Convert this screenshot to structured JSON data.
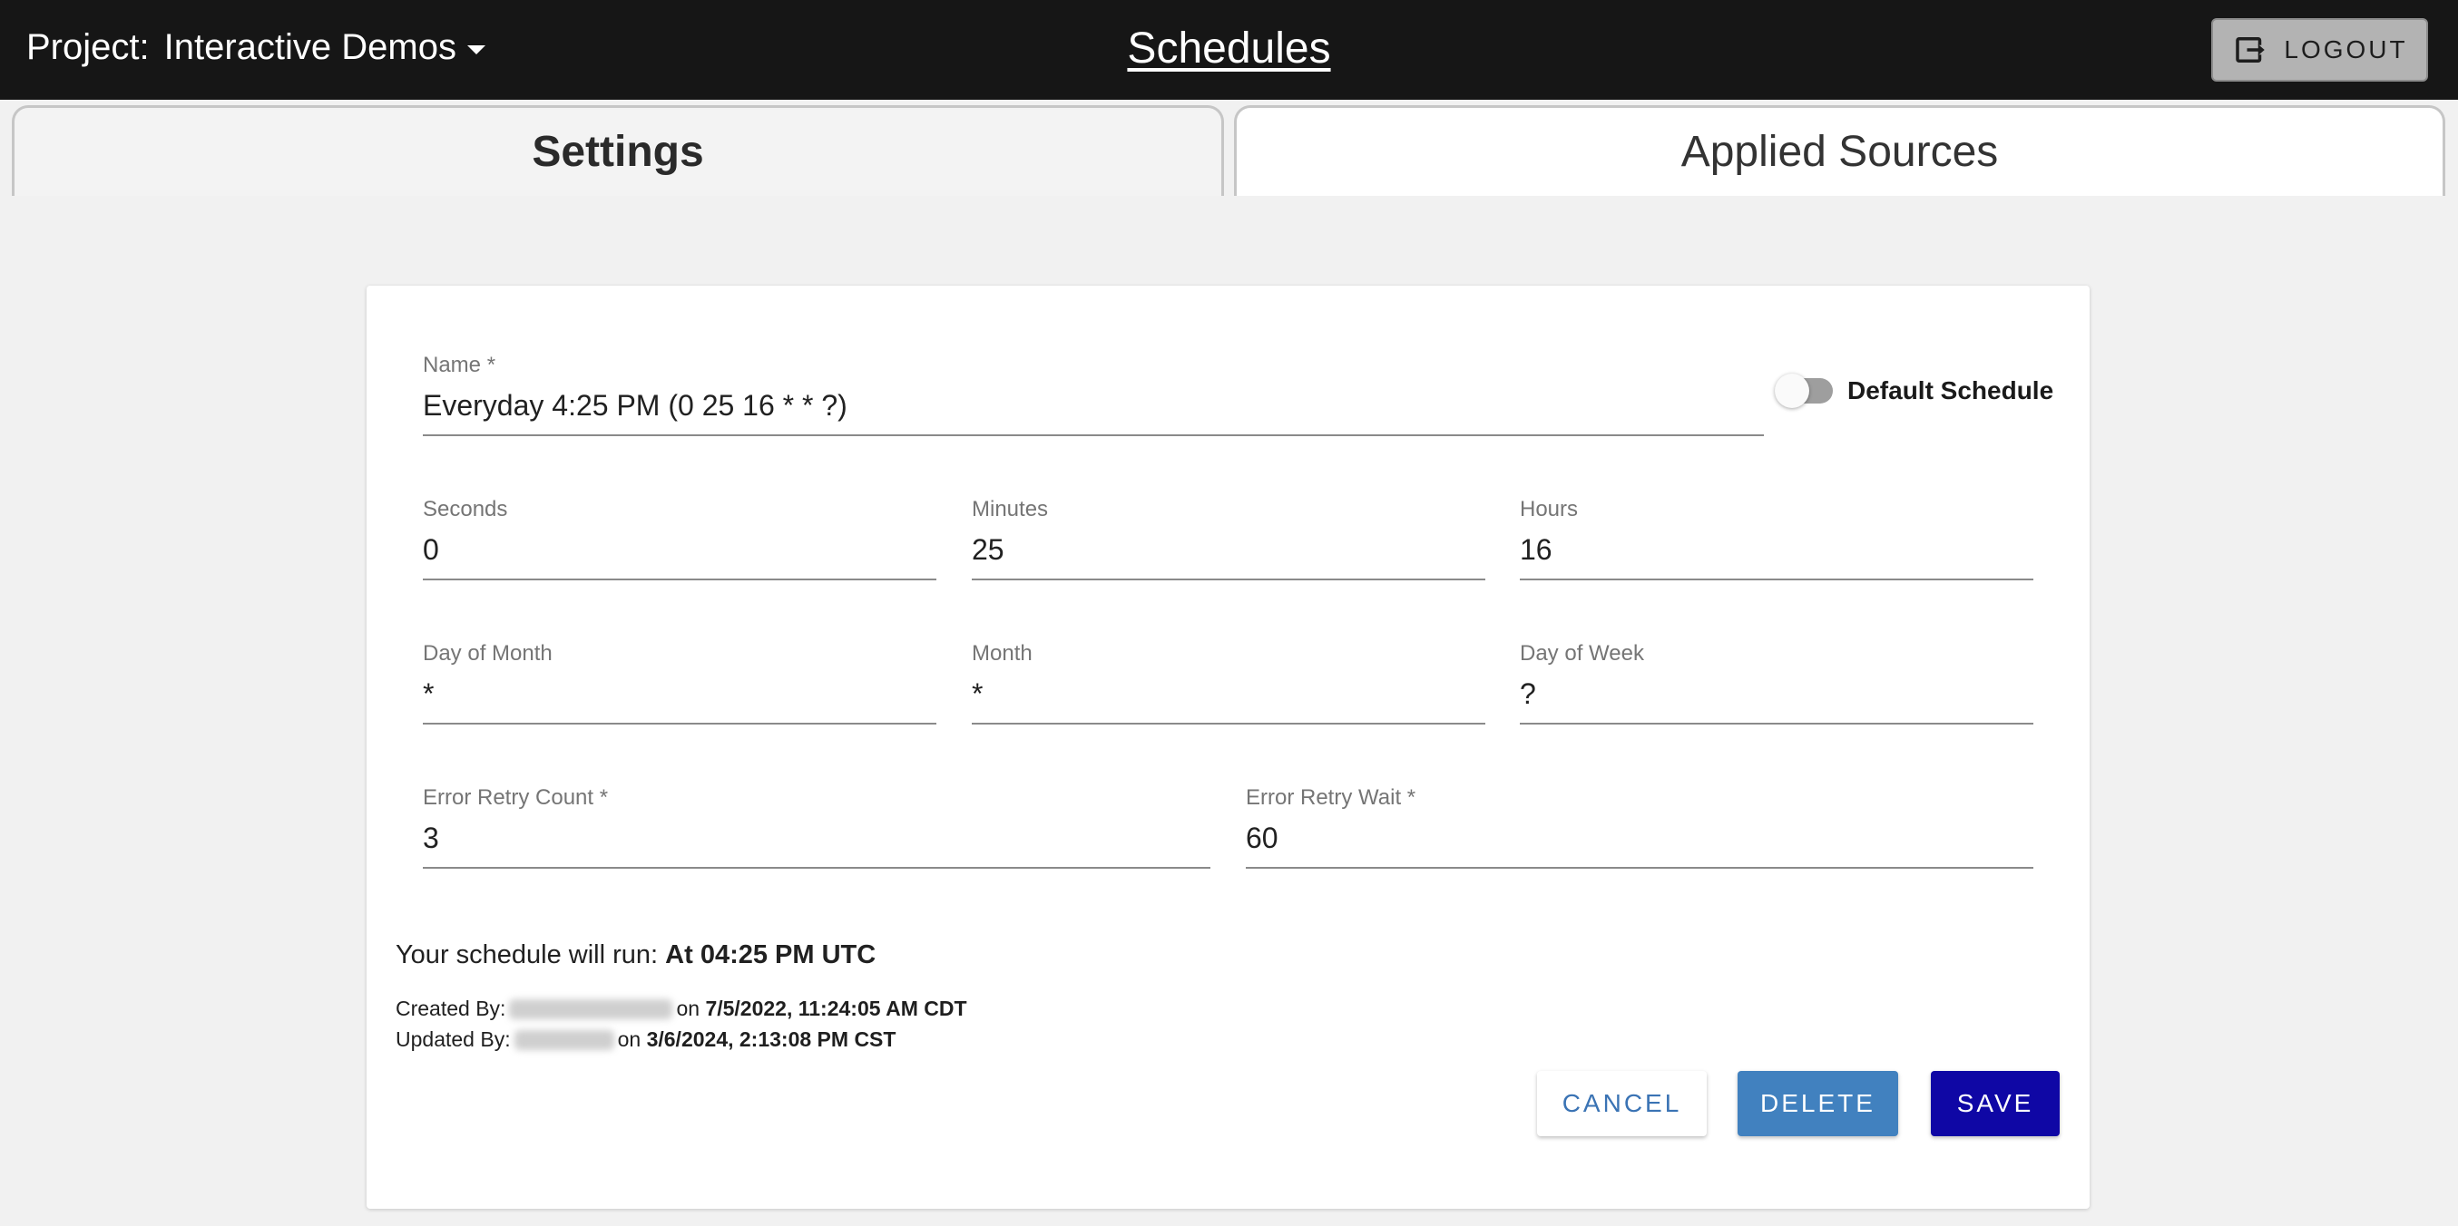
{
  "header": {
    "project_label": "Project:",
    "project_name": "Interactive Demos",
    "title": "Schedules",
    "logout_label": "LOGOUT"
  },
  "tabs": [
    {
      "label": "Settings",
      "active": true
    },
    {
      "label": "Applied Sources",
      "active": false
    }
  ],
  "form": {
    "name": {
      "label": "Name *",
      "value": "Everyday 4:25 PM (0 25 16 * * ?)"
    },
    "default_schedule": {
      "label": "Default Schedule",
      "checked": false
    },
    "seconds": {
      "label": "Seconds",
      "value": "0"
    },
    "minutes": {
      "label": "Minutes",
      "value": "25"
    },
    "hours": {
      "label": "Hours",
      "value": "16"
    },
    "day_of_month": {
      "label": "Day of Month",
      "value": "*"
    },
    "month": {
      "label": "Month",
      "value": "*"
    },
    "day_of_week": {
      "label": "Day of Week",
      "value": "?"
    },
    "error_retry_count": {
      "label": "Error Retry Count *",
      "value": "3"
    },
    "error_retry_wait": {
      "label": "Error Retry Wait *",
      "value": "60"
    }
  },
  "summary": {
    "run_prefix": "Your schedule will run: ",
    "run_value": "At 04:25 PM UTC",
    "created_prefix": "Created By:",
    "created_on": "on",
    "created_date": "7/5/2022, 11:24:05 AM CDT",
    "updated_prefix": "Updated By:",
    "updated_on": "on",
    "updated_date": "3/6/2024, 2:13:08 PM CST"
  },
  "actions": {
    "cancel": "CANCEL",
    "delete": "DELETE",
    "save": "SAVE"
  },
  "colors": {
    "topbar": "#161616",
    "save": "#0f07a5",
    "delete": "#4181bf",
    "cancel_text": "#3a73b4"
  },
  "icons": {
    "logout": "logout-icon",
    "caret": "chevron-down-icon"
  }
}
